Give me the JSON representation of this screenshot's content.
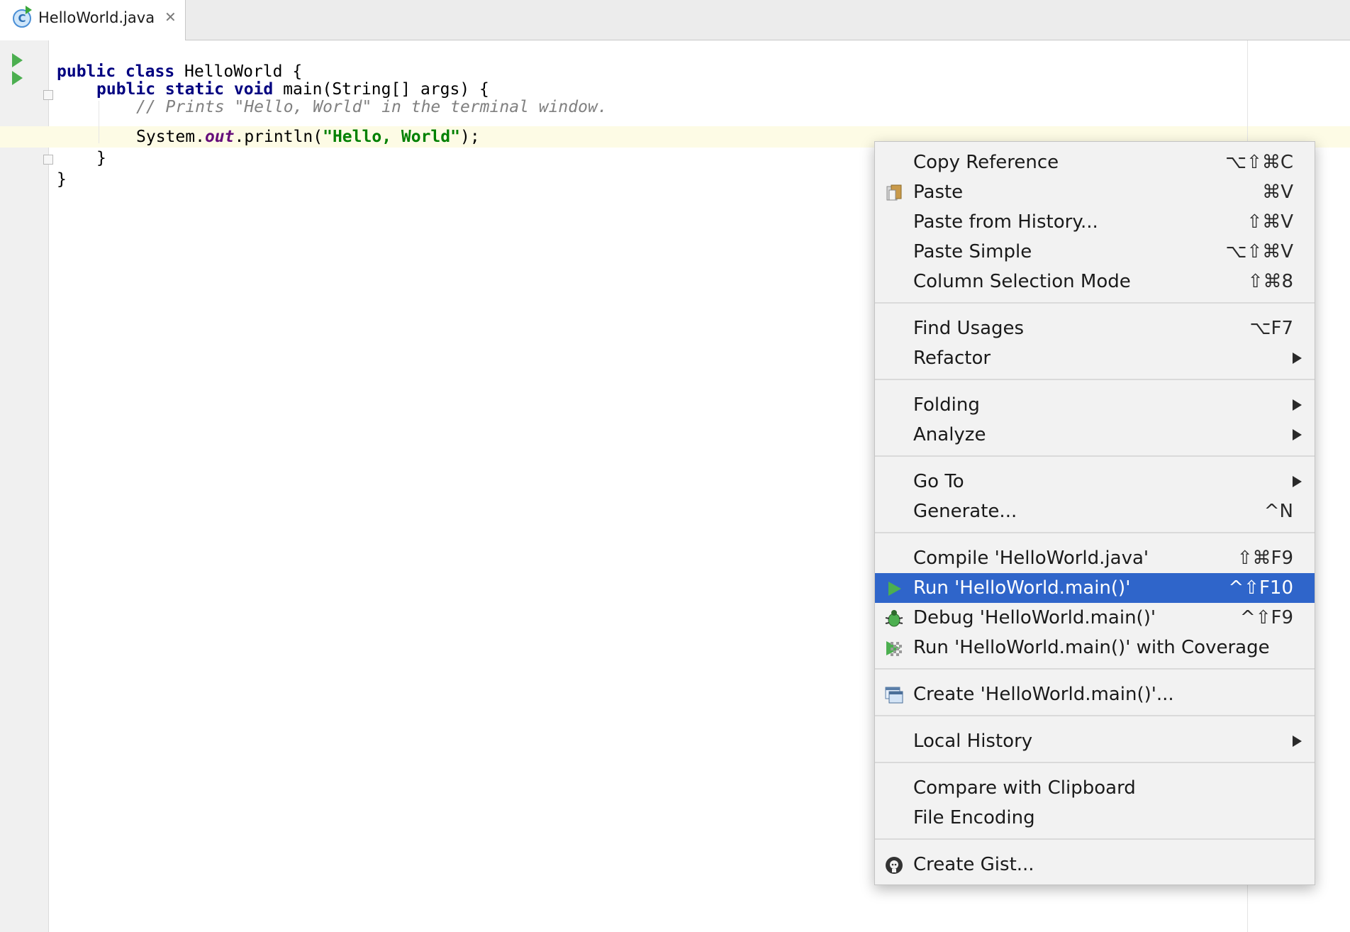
{
  "tab": {
    "label": "HelloWorld.java",
    "close": "✕",
    "icon_letter": "C"
  },
  "editor": {
    "lines": [
      [
        "public class",
        " HelloWorld {"
      ],
      [
        "public static void",
        " main(String[] args) {"
      ],
      [
        "// Prints \"Hello, World\" in the terminal window."
      ],
      [
        "System.",
        "out",
        ".println(",
        "\"Hello, World\"",
        ");"
      ],
      [
        "}"
      ],
      [
        "}"
      ]
    ]
  },
  "menu": {
    "items": [
      {
        "label": "Copy Reference",
        "shortcut": "⌥⇧⌘C"
      },
      {
        "label": "Paste",
        "shortcut": "⌘V",
        "icon": "paste-icon"
      },
      {
        "label": "Paste from History...",
        "shortcut": "⇧⌘V"
      },
      {
        "label": "Paste Simple",
        "shortcut": "⌥⇧⌘V"
      },
      {
        "label": "Column Selection Mode",
        "shortcut": "⇧⌘8"
      },
      {
        "label": "Find Usages",
        "shortcut": "⌥F7"
      },
      {
        "label": "Refactor",
        "submenu": true
      },
      {
        "label": "Folding",
        "submenu": true
      },
      {
        "label": "Analyze",
        "submenu": true
      },
      {
        "label": "Go To",
        "submenu": true
      },
      {
        "label": "Generate...",
        "shortcut": "^N"
      },
      {
        "label": "Compile 'HelloWorld.java'",
        "shortcut": "⇧⌘F9"
      },
      {
        "label": "Run 'HelloWorld.main()'",
        "shortcut": "^⇧F10",
        "icon": "run-icon",
        "selected": true
      },
      {
        "label": "Debug 'HelloWorld.main()'",
        "shortcut": "^⇧F9",
        "icon": "debug-bug-icon"
      },
      {
        "label": "Run 'HelloWorld.main()' with Coverage",
        "icon": "coverage-icon"
      },
      {
        "label": "Create 'HelloWorld.main()'...",
        "icon": "run-configuration-icon"
      },
      {
        "label": "Local History",
        "submenu": true
      },
      {
        "label": "Compare with Clipboard"
      },
      {
        "label": "File Encoding"
      },
      {
        "label": "Create Gist...",
        "icon": "github-icon"
      }
    ]
  },
  "colors": {
    "menu_selection": "#2f65ca",
    "run_green": "#4caf50",
    "keyword": "#000080",
    "string": "#008000",
    "comment": "#808080",
    "field": "#660e7a"
  }
}
